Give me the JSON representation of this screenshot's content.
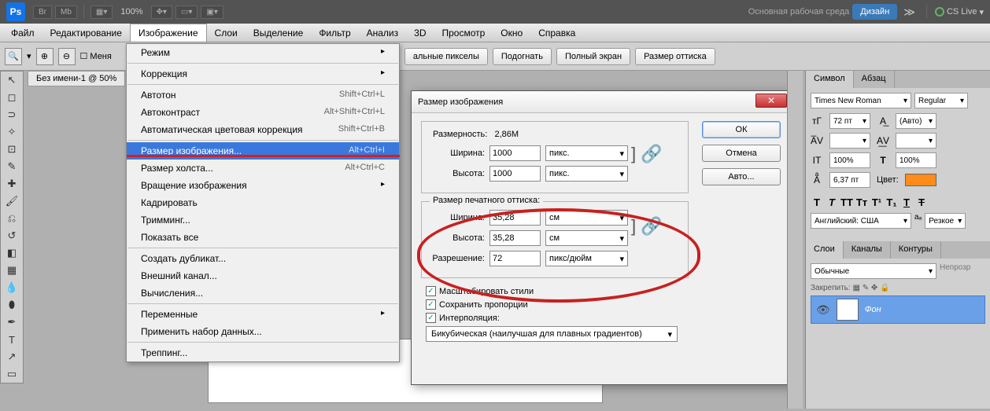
{
  "top": {
    "logo": "Ps",
    "br": "Br",
    "mb": "Mb",
    "zoom": "100%",
    "workspace_text": "Основная рабочая среда",
    "design_btn": "Дизайн",
    "cslive": "CS Live"
  },
  "menu": {
    "items": [
      "Файл",
      "Редактирование",
      "Изображение",
      "Слои",
      "Выделение",
      "Фильтр",
      "Анализ",
      "3D",
      "Просмотр",
      "Окно",
      "Справка"
    ],
    "active_index": 2
  },
  "options": {
    "menya": "Меня",
    "btns": [
      "альные пикселы",
      "Подогнать",
      "Полный экран",
      "Размер оттиска"
    ]
  },
  "doc_tab": "Без имени-1 @ 50%",
  "dropdown": {
    "groups": [
      [
        {
          "label": "Режим",
          "sub": true
        }
      ],
      [
        {
          "label": "Коррекция",
          "sub": true
        }
      ],
      [
        {
          "label": "Автотон",
          "shortcut": "Shift+Ctrl+L"
        },
        {
          "label": "Автоконтраст",
          "shortcut": "Alt+Shift+Ctrl+L"
        },
        {
          "label": "Автоматическая цветовая коррекция",
          "shortcut": "Shift+Ctrl+B"
        }
      ],
      [
        {
          "label": "Размер изображения...",
          "shortcut": "Alt+Ctrl+I",
          "hl": true
        },
        {
          "label": "Размер холста...",
          "shortcut": "Alt+Ctrl+C"
        },
        {
          "label": "Вращение изображения",
          "sub": true
        },
        {
          "label": "Кадрировать"
        },
        {
          "label": "Тримминг..."
        },
        {
          "label": "Показать все"
        }
      ],
      [
        {
          "label": "Создать дубликат..."
        },
        {
          "label": "Внешний канал..."
        },
        {
          "label": "Вычисления..."
        }
      ],
      [
        {
          "label": "Переменные",
          "sub": true
        },
        {
          "label": "Применить набор данных..."
        }
      ],
      [
        {
          "label": "Треппинг..."
        }
      ]
    ]
  },
  "dialog": {
    "title": "Размер изображения",
    "dim_label": "Размерность:",
    "dim_value": "2,86M",
    "width_label": "Ширина:",
    "height_label": "Высота:",
    "px_w": "1000",
    "px_h": "1000",
    "px_unit": "пикс.",
    "print_legend": "Размер печатного оттиска:",
    "print_w": "35,28",
    "print_h": "35,28",
    "print_unit": "см",
    "res_label": "Разрешение:",
    "res_val": "72",
    "res_unit": "пикс/дюйм",
    "ok": "ОК",
    "cancel": "Отмена",
    "auto": "Авто...",
    "scale_styles": "Масштабировать стили",
    "keep_prop": "Сохранить пропорции",
    "interp_label": "Интерполяция:",
    "interp_value": "Бикубическая (наилучшая для плавных градиентов)"
  },
  "right": {
    "tabs1": [
      "Символ",
      "Абзац"
    ],
    "font": "Times New Roman",
    "style": "Regular",
    "size": "72 пт",
    "leading": "(Авто)",
    "track": "",
    "kern": "",
    "scale_h": "100%",
    "scale_v": "100%",
    "baseline": "6,37 пт",
    "color_label": "Цвет:",
    "lang": "Английский: США",
    "aa": "Резкое",
    "tabs2": [
      "Слои",
      "Каналы",
      "Контуры"
    ],
    "blend": "Обычные",
    "opacity_label": "Непрозр",
    "lock_label": "Закрепить:",
    "layer_name": "Фон"
  }
}
